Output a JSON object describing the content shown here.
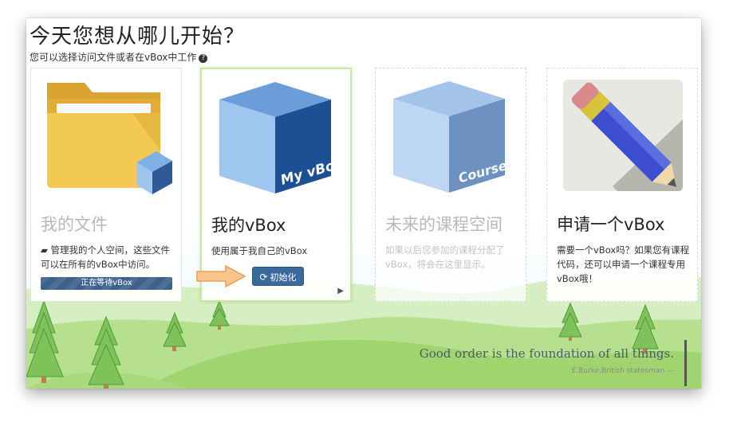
{
  "header": {
    "title": "今天您想从哪儿开始？",
    "subtitle": "您可以选择访问文件或者在vBox中工作",
    "help_icon": "question-circle-icon"
  },
  "cards": [
    {
      "title": "我的文件",
      "desc_icon": "folder-open-icon",
      "description": "管理我的个人空间，这些文件可以在所有的vBox中访问。",
      "status_label": "正在等待vBox"
    },
    {
      "title": "我的vBox",
      "cube_label": "My vBox",
      "description": "使用属于我自己的vBox",
      "button_label": "初始化",
      "button_icon": "refresh-icon",
      "pointer_icon": "play-icon"
    },
    {
      "title": "未来的课程空间",
      "cube_label": "Course",
      "description": "如果以后您参加的课程分配了vBox，将会在这里显示。"
    },
    {
      "title": "申请一个vBox",
      "description": "需要一个vBox吗？如果您有课程代码，还可以申请一个课程专用vBox哦！"
    }
  ],
  "quote": {
    "text": "Good order is the foundation of all things.",
    "author": "E.Burke,British statesman —"
  },
  "colors": {
    "primary_button": "#3a6a9c",
    "selected_border": "#c8e6a8",
    "hill_green": "#a8d878"
  }
}
